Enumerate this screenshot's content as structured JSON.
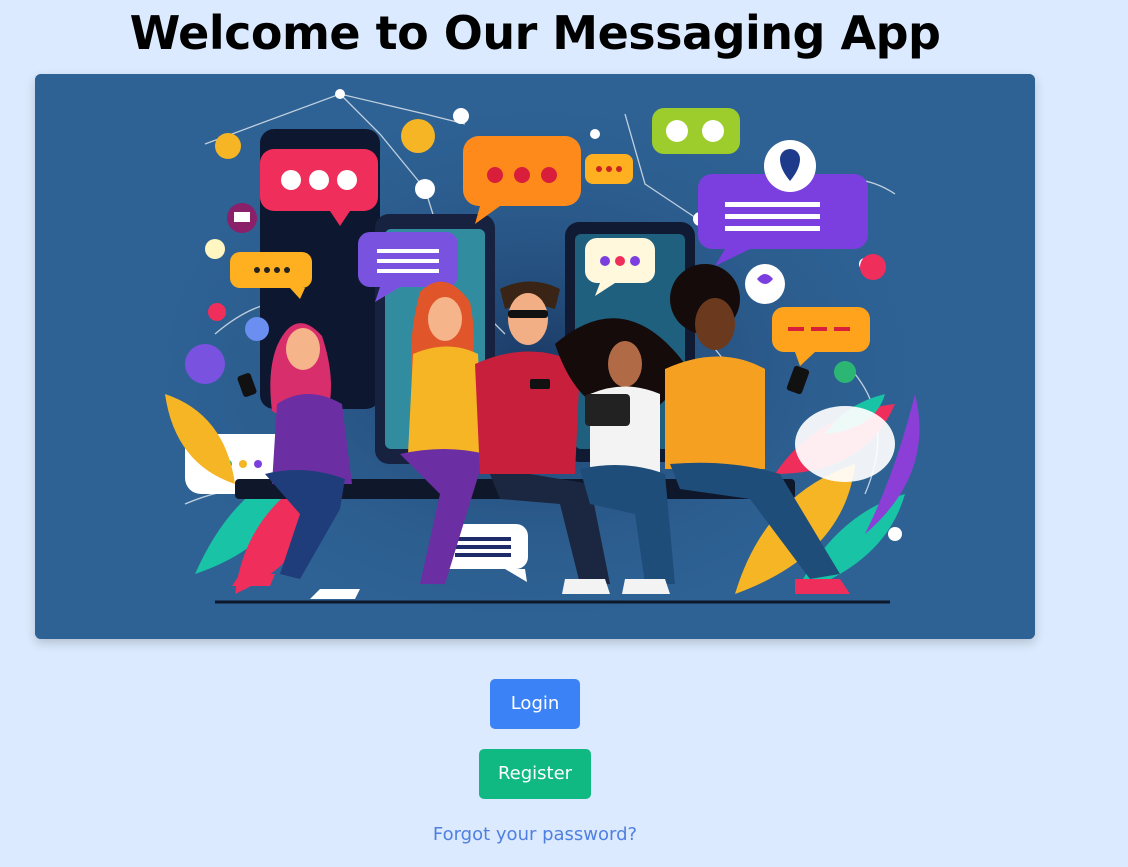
{
  "page": {
    "title": "Welcome to Our Messaging App"
  },
  "hero": {
    "image_alt": "Illustration of people using phones and tablets surrounded by chat bubbles",
    "background_color": "#2e6294"
  },
  "actions": {
    "login_label": "Login",
    "register_label": "Register",
    "forgot_label": "Forgot your password?"
  },
  "colors": {
    "page_background": "#dbeafe",
    "login_button": "#3b82f6",
    "register_button": "#10b981",
    "link": "#4f7fe0"
  }
}
